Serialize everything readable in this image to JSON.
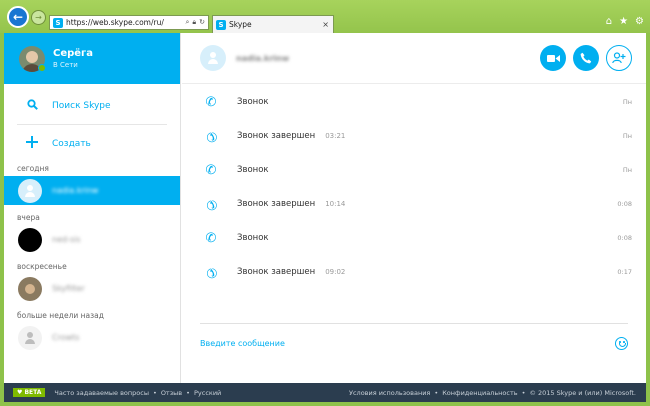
{
  "browser": {
    "url": "https://web.skype.com/ru/",
    "tab_title": "Skype",
    "tab_close": "×"
  },
  "profile": {
    "name": "Серёга",
    "status": "В Сети"
  },
  "actions": {
    "search_label": "Поиск Skype",
    "create_label": "Создать"
  },
  "sections": {
    "today": "сегодня",
    "yesterday": "вчера",
    "sunday": "воскресенье",
    "older": "больше недели назад"
  },
  "contacts": {
    "today_1": "nadia.krinw",
    "yesterday_1": "ned-sis",
    "sunday_1": "Skyfilter",
    "older_1": "Crowts"
  },
  "conversation": {
    "name": "nadia.krinw",
    "messages": [
      {
        "text": "Звонок",
        "duration": "",
        "time": "Пн",
        "type": "call"
      },
      {
        "text": "Звонок завершен",
        "duration": "03:21",
        "time": "Пн",
        "type": "end"
      },
      {
        "text": "Звонок",
        "duration": "",
        "time": "Пн",
        "type": "call"
      },
      {
        "text": "Звонок завершен",
        "duration": "10:14",
        "time": "0:08",
        "type": "end"
      },
      {
        "text": "Звонок",
        "duration": "",
        "time": "0:08",
        "type": "call"
      },
      {
        "text": "Звонок завершен",
        "duration": "09:02",
        "time": "0:17",
        "type": "end"
      }
    ],
    "composer_placeholder": "Введите сообщение"
  },
  "footer": {
    "beta": "♥ BETA",
    "faq": "Часто задаваемые вопросы",
    "feedback": "Отзыв",
    "language": "Русский",
    "terms": "Условия использования",
    "privacy": "Конфиденциальность",
    "copyright": "© 2015 Skype и (или) Microsoft."
  },
  "colors": {
    "accent": "#00aff0",
    "chrome": "#94c44c",
    "footer": "#2b3d4f",
    "online": "#7fba00"
  }
}
